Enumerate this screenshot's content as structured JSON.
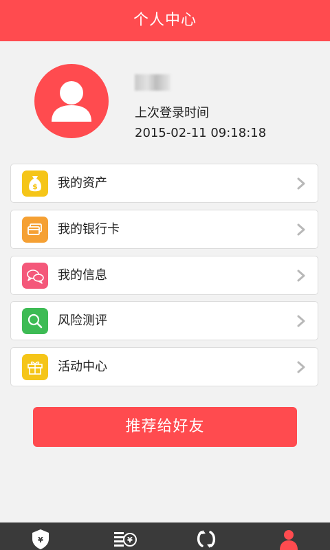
{
  "header": {
    "title": "个人中心"
  },
  "profile": {
    "username": "",
    "last_login_label": "上次登录时间",
    "last_login_time": "2015-02-11 09:18:18"
  },
  "menu": [
    {
      "label": "我的资产",
      "icon": "money-bag-icon",
      "color": "#f5c518"
    },
    {
      "label": "我的银行卡",
      "icon": "bank-card-icon",
      "color": "#f5a033"
    },
    {
      "label": "我的信息",
      "icon": "chat-bubbles-icon",
      "color": "#f4587a"
    },
    {
      "label": "风险测评",
      "icon": "magnifier-icon",
      "color": "#3dbb54"
    },
    {
      "label": "活动中心",
      "icon": "gift-icon",
      "color": "#f5c518"
    }
  ],
  "recommend_button": {
    "label": "推荐给好友"
  },
  "bottom_nav": [
    {
      "icon": "shield-yen-icon",
      "active": false
    },
    {
      "icon": "yen-list-icon",
      "active": false
    },
    {
      "icon": "refresh-icon",
      "active": false
    },
    {
      "icon": "user-icon",
      "active": true
    }
  ],
  "colors": {
    "accent": "#ff4b4f",
    "nav_bg": "#3a3a3a",
    "page_bg": "#f2f2f2"
  }
}
